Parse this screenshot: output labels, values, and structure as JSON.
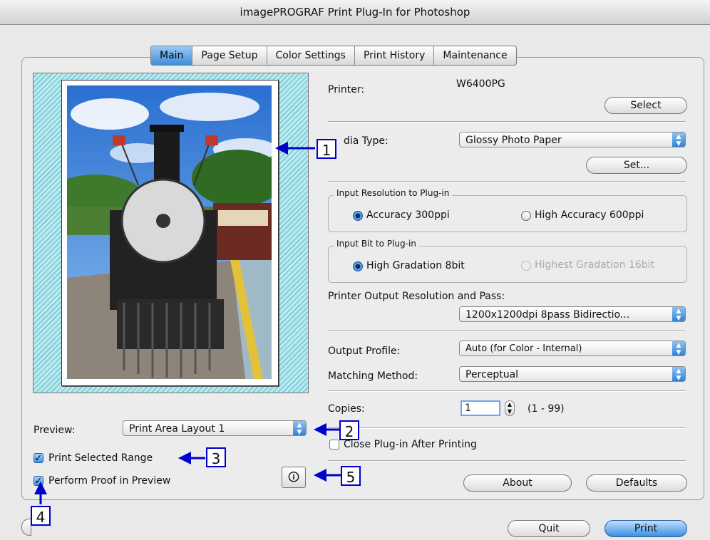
{
  "window": {
    "title": "imagePROGRAF Print Plug-In for Photoshop"
  },
  "tabs": [
    "Main",
    "Page Setup",
    "Color Settings",
    "Print History",
    "Maintenance"
  ],
  "printer": {
    "label": "Printer:",
    "value": "W6400PG",
    "select_button": "Select"
  },
  "media": {
    "label": "dia Type:",
    "value": "Glossy Photo Paper",
    "set_button": "Set..."
  },
  "input_resolution": {
    "title": "Input Resolution to Plug-in",
    "option_1": "Accuracy 300ppi",
    "option_2": "High Accuracy 600ppi",
    "selected": "Accuracy 300ppi"
  },
  "input_bit": {
    "title": "Input Bit to Plug-in",
    "option_1": "High Gradation 8bit",
    "option_2": "Highest Gradation 16bit",
    "selected": "High Gradation 8bit"
  },
  "output_resolution": {
    "label": "Printer Output Resolution and Pass:",
    "value": "1200x1200dpi 8pass Bidirectio..."
  },
  "output_profile": {
    "label": "Output Profile:",
    "value": "Auto (for Color - Internal)"
  },
  "matching_method": {
    "label": "Matching Method:",
    "value": "Perceptual"
  },
  "copies": {
    "label": "Copies:",
    "value": "1",
    "range": "(1 - 99)"
  },
  "close_after": {
    "label": "Close Plug-in After Printing",
    "checked": false
  },
  "buttons": {
    "about": "About",
    "defaults": "Defaults",
    "quit": "Quit",
    "print": "Print"
  },
  "preview": {
    "label": "Preview:",
    "value": "Print Area Layout 1"
  },
  "print_selected": {
    "label": "Print Selected Range",
    "checked": true
  },
  "proof_preview": {
    "label": "Perform Proof in Preview",
    "checked": true
  },
  "callouts": [
    "1",
    "2",
    "3",
    "4",
    "5"
  ],
  "colors": {
    "accent": "#3c8fe0",
    "callout": "#0000cc"
  }
}
